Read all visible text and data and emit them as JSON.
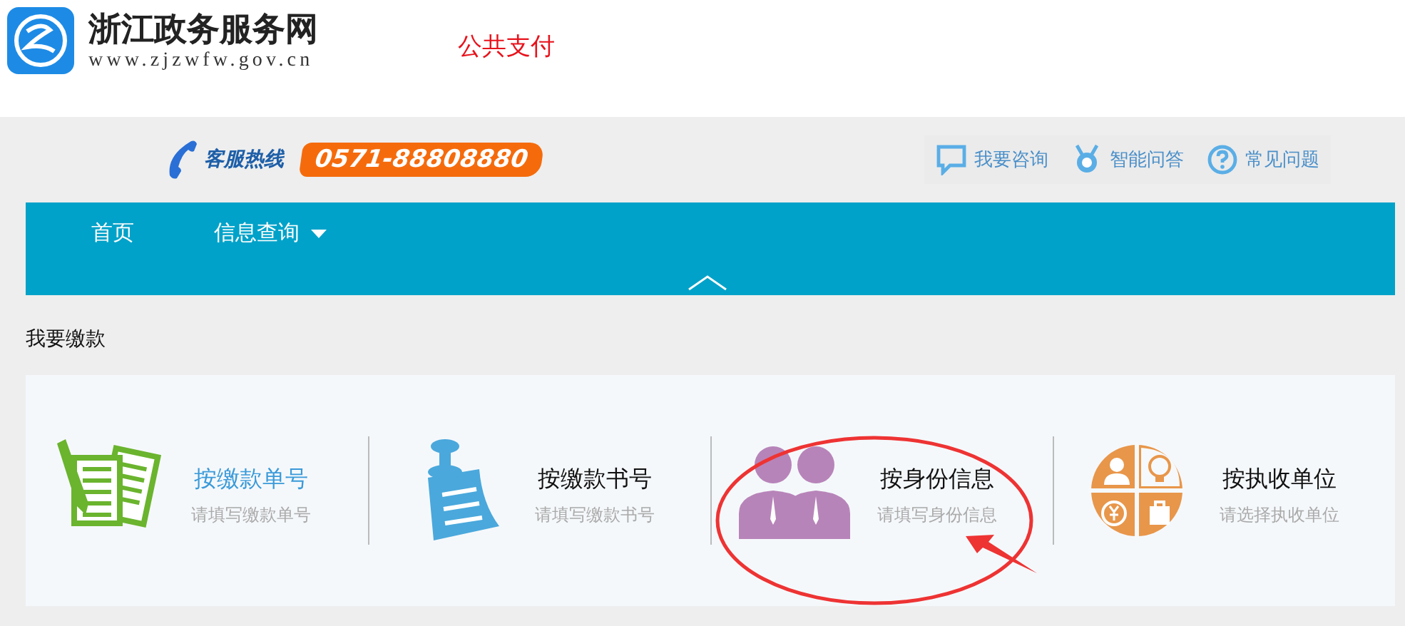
{
  "header": {
    "site_title": "浙江政务服务网",
    "site_url": "www.zjzwfw.gov.cn",
    "page_title": "公共支付"
  },
  "hotline": {
    "label": "客服热线",
    "number": "0571-88808880"
  },
  "help_links": [
    {
      "kind": "chat",
      "label": "我要咨询"
    },
    {
      "kind": "robot",
      "label": "智能问答"
    },
    {
      "kind": "question",
      "label": "常见问题"
    }
  ],
  "nav": [
    {
      "label": "首页",
      "dropdown": false
    },
    {
      "label": "信息查询",
      "dropdown": true
    }
  ],
  "section_title": "我要缴款",
  "pay_options": [
    {
      "kind": "bill",
      "title": "按缴款单号",
      "hint": "请填写缴款单号",
      "selected": true,
      "circled": false
    },
    {
      "kind": "pin",
      "title": "按缴款书号",
      "hint": "请填写缴款书号",
      "selected": false,
      "circled": false
    },
    {
      "kind": "people",
      "title": "按身份信息",
      "hint": "请填写身份信息",
      "selected": false,
      "circled": true
    },
    {
      "kind": "unit",
      "title": "按执收单位",
      "hint": "请选择执收单位",
      "selected": false,
      "circled": false
    }
  ]
}
